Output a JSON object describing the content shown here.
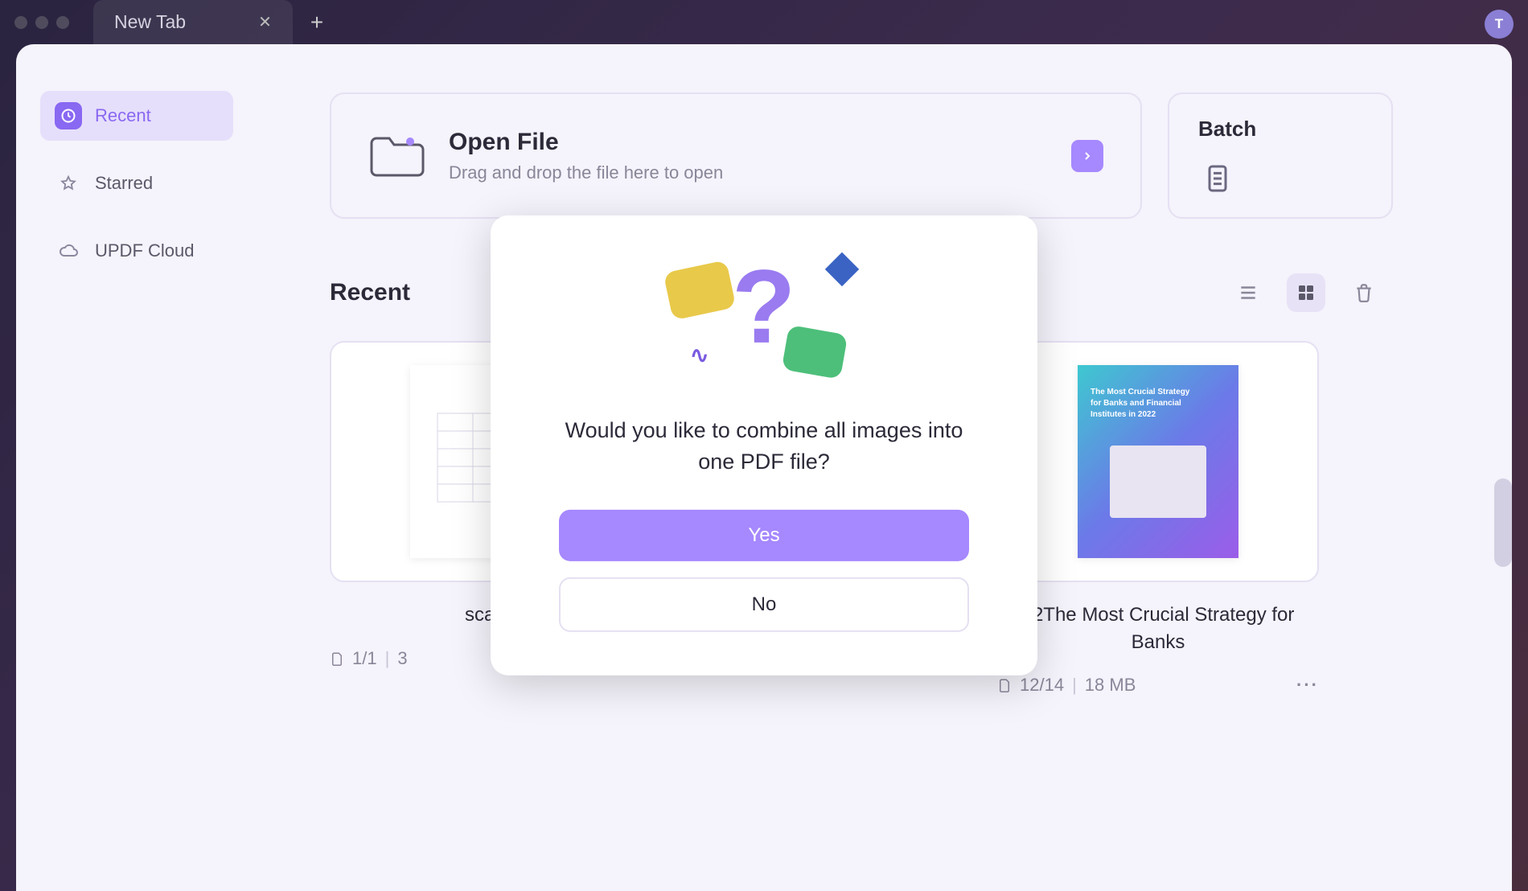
{
  "tab": {
    "title": "New Tab"
  },
  "avatar": {
    "initial": "T"
  },
  "sidebar": {
    "items": [
      {
        "label": "Recent",
        "icon": "clock-icon",
        "active": true
      },
      {
        "label": "Starred",
        "icon": "star-icon",
        "active": false
      },
      {
        "label": "UPDF Cloud",
        "icon": "cloud-icon",
        "active": false
      }
    ]
  },
  "open_file": {
    "title": "Open File",
    "subtitle": "Drag and drop the file here to open"
  },
  "batch": {
    "title": "Batch"
  },
  "recent": {
    "title": "Recent"
  },
  "files": [
    {
      "title": "scann",
      "pages": "1/1",
      "size": "3"
    },
    {
      "title": "12The Most Crucial Strategy for Banks",
      "pages": "12/14",
      "size": "18 MB"
    }
  ],
  "dialog": {
    "message": "Would you like to combine all images into one PDF file?",
    "yes": "Yes",
    "no": "No"
  }
}
